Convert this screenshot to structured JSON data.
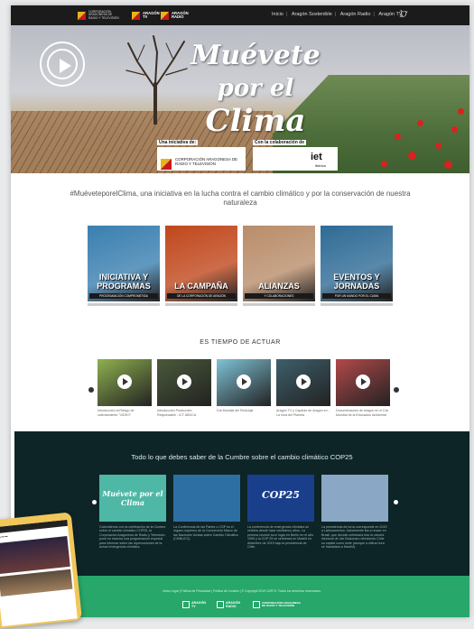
{
  "header": {
    "logo1": "CORPORACIÓN ARAGONESA DE RADIO Y TELEVISIÓN",
    "logo2": "ARAGÓN TV",
    "logo3": "ARAGÓN RADIO",
    "nav": [
      "Inicio",
      "Aragón Sostenible",
      "Aragón Radio",
      "Aragón TV"
    ]
  },
  "hero": {
    "slogan1": "Muévete",
    "slogan2": "por el",
    "slogan3": "Clima",
    "initiative_label": "Una iniciativa de:",
    "initiative_org": "CORPORACIÓN ARAGONESA DE RADIO Y TELEVISIÓN",
    "collab_label": "Con la colaboración de",
    "collab_org": "iet",
    "collab_sub": "ibérica"
  },
  "intro": "#MuéveteporelClima, una iniciativa en la lucha contra el cambio climático y por la conservación de nuestra naturaleza",
  "cards": [
    {
      "label": "INICIATIVA Y PROGRAMAS",
      "sub": "PROGRAMACIÓN COMPROMETIDA",
      "color": "#3a7fb0"
    },
    {
      "label": "LA CAMPAÑA",
      "sub": "DE LA CORPORACIÓN DE ARAGÓN",
      "color": "#c0471c"
    },
    {
      "label": "ALIANZAS",
      "sub": "Y COLABORACIONES",
      "color": "#b98d6a"
    },
    {
      "label": "EVENTOS Y JORNADAS",
      "sub": "POR UN MUNDO POR EL CLIMA",
      "color": "#2f6b96"
    }
  ],
  "videos_title": "ES TIEMPO DE ACTUAR",
  "videos": [
    {
      "caption": "Introducción al Riesgo de calentamiento \"VIDEO\"",
      "color": "#8fb14f"
    },
    {
      "caption": "Introducción Producción Responsable - ICT ABOCA",
      "color": "#4a5a3a"
    },
    {
      "caption": "Día Mundial del Reciclaje",
      "color": "#7fc3d6"
    },
    {
      "caption": "Aragón TV y Capítulo de Aragon en - La hora del Planeta",
      "color": "#3e5f6b"
    },
    {
      "caption": "Documentación de Aragón en el Día Mundial de la Educación Ambiental",
      "color": "#b3494a"
    }
  ],
  "cumbre": {
    "title": "Todo lo que debes saber de la Cumbre sobre el cambio climático COP25",
    "items": [
      {
        "img_text": "Muévete por el Clima",
        "text": "Coincidiendo con la celebración de la Cumbre sobre el cambio climático COP25, la Corporación Aragonesa de Radio y Televisión pone en marcha una programación especial para informar sobre las repercusiones de la actual emergencia climática.",
        "color": "#4fb7a6"
      },
      {
        "img_text": "",
        "text": "La Conferencia de las Partes o COP es el órgano supremo de la Convención Marco de las Naciones Unidas sobre Cambio Climático (CMNUCC).",
        "color": "#2d6ea3"
      },
      {
        "img_text": "COP25",
        "text": "La conferencia de emergencia climática se celebra desde hace veinticinco años. La primera reunión tuvo lugar en Berlín en el año 1995 y la COP 25 se celebrará en Madrid en diciembre de 2019 bajo la presidencia de Chile.",
        "color": "#1a3f8a"
      },
      {
        "img_text": "",
        "text": "La presidencia de turno corresponde en 2019 a Latinoamérica. Inicialmente iba a recaer en Brasil, que decidió celebrarla tras la victoria electoral de Jair Bolsonaro ofreciendo Chile su capital como sede (aunque a última hora se trasladara a Madrid).",
        "color": "#8aa8c6"
      }
    ]
  },
  "footer": {
    "legal": "Aviso Legal | Política de Privacidad | Política de Cookies | © Copyright 2019 CARTV. Todos los derechos reservados.",
    "logos": [
      "ARAGÓN TV",
      "ARAGÓN RADIO",
      "CORPORACIÓN ARAGONESA DE RADIO Y TELEVISIÓN"
    ]
  },
  "colors": {
    "topbar": "#1b1b1b",
    "dark_section": "#0e2528",
    "footer": "#27a86a"
  }
}
